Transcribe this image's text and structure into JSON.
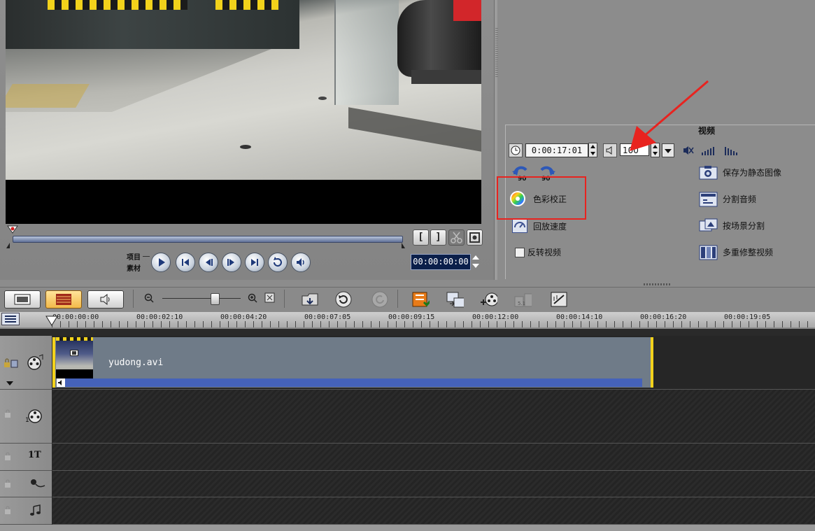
{
  "preview": {
    "mode_project": "项目",
    "mode_clip": "素材",
    "timecode": "00:00:00:00",
    "trim_start": "[",
    "trim_end": "]"
  },
  "options": {
    "tab_label": "视频",
    "duration": "0:00:17:01",
    "volume": "100",
    "rotate_left_icon": "rotate-left-90-icon",
    "rotate_right_icon": "rotate-right-90-icon",
    "items_left": [
      {
        "label": "色彩校正"
      },
      {
        "label": "回放速度"
      },
      {
        "label": "反转视频"
      }
    ],
    "items_right": [
      {
        "label": "保存为静态图像"
      },
      {
        "label": "分割音频"
      },
      {
        "label": "按场景分割"
      },
      {
        "label": "多重修整视频"
      }
    ],
    "annotation_color": "#e8231f"
  },
  "timeline": {
    "ruler": [
      "00:00:00:00",
      "00:00:02:10",
      "00:00:04:20",
      "00:00:07:05",
      "00:00:09:15",
      "00:00:12:00",
      "00:00:14:10",
      "00:00:16:20",
      "00:00:19:05"
    ],
    "clip_name": "yudong.avi",
    "title_track_label": "1T"
  }
}
